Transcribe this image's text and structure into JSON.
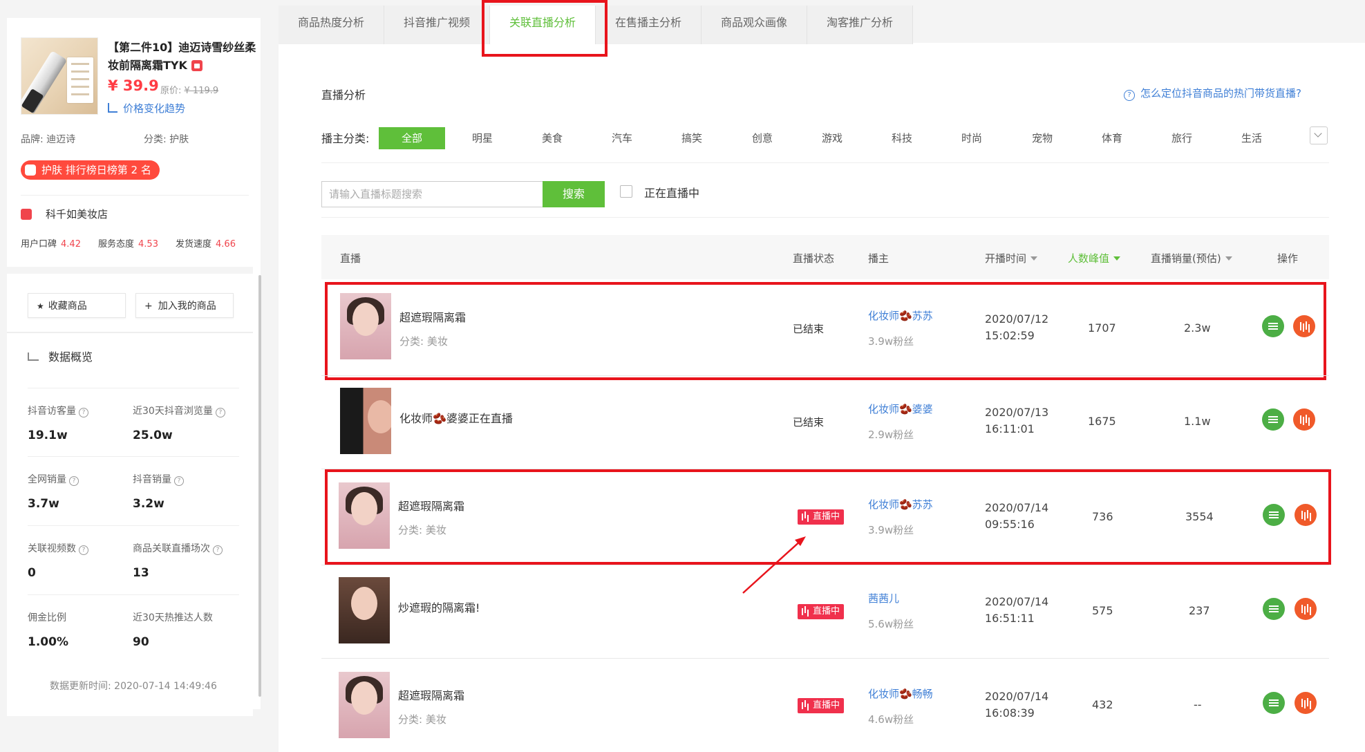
{
  "product": {
    "title": "【第二件10】迪迈诗雪纱丝柔妆前隔离霜TYK",
    "price": "¥ 39.9",
    "orig_label": "原价:",
    "orig_price": "¥ 119.9",
    "trend_link": "价格变化趋势",
    "brand": "品牌: 迪迈诗",
    "category": "分类: 护肤",
    "rank_badge": "护肤 排行榜日榜第 2 名",
    "store": "科千如美妆店",
    "scores": [
      {
        "label": "用户口碑",
        "value": "4.42"
      },
      {
        "label": "服务态度",
        "value": "4.53"
      },
      {
        "label": "发货速度",
        "value": "4.66"
      }
    ],
    "actions": {
      "favorite": "收藏商品",
      "add": "加入我的商品"
    },
    "overview_title": "数据概览",
    "stats": [
      {
        "label": "抖音访客量",
        "value": "19.1w",
        "help": true
      },
      {
        "label": "近30天抖音浏览量",
        "value": "25.0w",
        "help": true
      },
      {
        "label": "全网销量",
        "value": "3.7w",
        "help": true
      },
      {
        "label": "抖音销量",
        "value": "3.2w",
        "help": true
      },
      {
        "label": "关联视频数",
        "value": "0",
        "help": true
      },
      {
        "label": "商品关联直播场次",
        "value": "13",
        "help": true
      },
      {
        "label": "佣金比例",
        "value": "1.00%",
        "help": false
      },
      {
        "label": "近30天热推达人数",
        "value": "90",
        "help": false
      }
    ],
    "updated": "数据更新时间: 2020-07-14 14:49:46"
  },
  "tabs": [
    "商品热度分析",
    "抖音推广视频",
    "关联直播分析",
    "在售播主分析",
    "商品观众画像",
    "淘客推广分析"
  ],
  "active_tab": 2,
  "section_title": "直播分析",
  "help_text": "怎么定位抖音商品的热门带货直播?",
  "filter_label": "播主分类:",
  "categories": [
    "全部",
    "明星",
    "美食",
    "汽车",
    "搞笑",
    "创意",
    "游戏",
    "科技",
    "时尚",
    "宠物",
    "体育",
    "旅行",
    "生活"
  ],
  "search": {
    "placeholder": "请输入直播标题搜索",
    "button": "搜索",
    "live_only": "正在直播中"
  },
  "columns": [
    "直播",
    "直播状态",
    "播主",
    "开播时间",
    "人数峰值",
    "直播销量(预估)",
    "操作"
  ],
  "rows": [
    {
      "title": "超遮瑕隔离霜",
      "category": "分类: 美妆",
      "status": "已结束",
      "live": false,
      "host": "化妆师🫘苏苏",
      "fans": "3.9w粉丝",
      "date": "2020/07/12",
      "time": "15:02:59",
      "peak": "1707",
      "sales": "2.3w"
    },
    {
      "title": "化妆师🫘婆婆正在直播",
      "category": "",
      "status": "已结束",
      "live": false,
      "host": "化妆师🫘婆婆",
      "fans": "2.9w粉丝",
      "date": "2020/07/13",
      "time": "16:11:01",
      "peak": "1675",
      "sales": "1.1w"
    },
    {
      "title": "超遮瑕隔离霜",
      "category": "分类: 美妆",
      "status": "直播中",
      "live": true,
      "host": "化妆师🫘苏苏",
      "fans": "3.9w粉丝",
      "date": "2020/07/14",
      "time": "09:55:16",
      "peak": "736",
      "sales": "3554"
    },
    {
      "title": "炒遮瑕的隔离霜!",
      "category": "",
      "status": "直播中",
      "live": true,
      "host": "茜茜儿",
      "fans": "5.6w粉丝",
      "date": "2020/07/14",
      "time": "16:51:11",
      "peak": "575",
      "sales": "237"
    },
    {
      "title": "超遮瑕隔离霜",
      "category": "分类: 美妆",
      "status": "直播中",
      "live": true,
      "host": "化妆师🫘畅畅",
      "fans": "4.6w粉丝",
      "date": "2020/07/14",
      "time": "16:08:39",
      "peak": "432",
      "sales": "--"
    }
  ],
  "colors": {
    "accent": "#5fbf3a",
    "highlight": "#e8141c",
    "live": "#f0304c",
    "link": "#3f7fd6"
  }
}
